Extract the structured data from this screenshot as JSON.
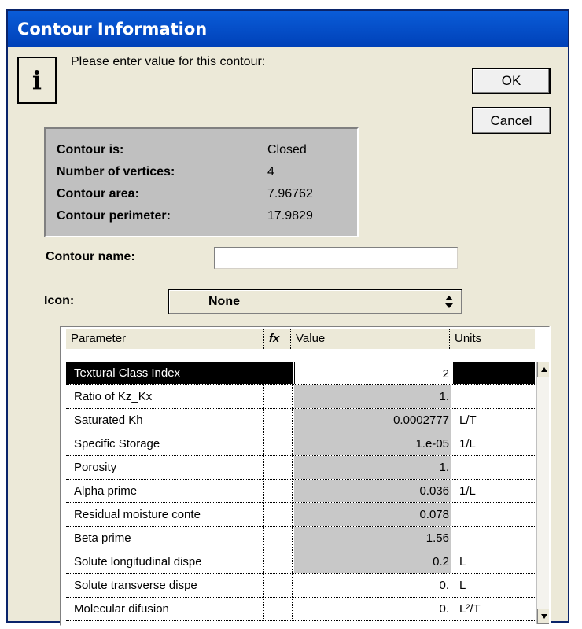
{
  "window": {
    "title": "Contour Information"
  },
  "icons": {
    "info": "info-icon",
    "select_arrow": "up-down-arrow-icon",
    "fx": "function-icon"
  },
  "prompt": {
    "text": "Please enter value for this contour:"
  },
  "buttons": {
    "ok": "OK",
    "cancel": "Cancel"
  },
  "stats": [
    {
      "label": "Contour is:",
      "value": "Closed"
    },
    {
      "label": "Number of vertices:",
      "value": "4"
    },
    {
      "label": "Contour area:",
      "value": "7.96762"
    },
    {
      "label": "Contour perimeter:",
      "value": "17.9829"
    }
  ],
  "contour_name": {
    "label": "Contour name:",
    "value": ""
  },
  "icon_select": {
    "label": "Icon:",
    "selected": "None"
  },
  "grid": {
    "headers": {
      "parameter": "Parameter",
      "fx": "fx",
      "value": "Value",
      "units": "Units"
    },
    "rows": [
      {
        "parameter": "Textural Class Index",
        "value": "2",
        "units": ""
      },
      {
        "parameter": "Ratio of Kz_Kx",
        "value": "1.",
        "units": ""
      },
      {
        "parameter": "Saturated Kh",
        "value": "0.0002777",
        "units": "L/T"
      },
      {
        "parameter": "Specific Storage",
        "value": "1.e-05",
        "units": "1/L"
      },
      {
        "parameter": "Porosity",
        "value": "1.",
        "units": ""
      },
      {
        "parameter": "Alpha prime",
        "value": "0.036",
        "units": "1/L"
      },
      {
        "parameter": "Residual moisture conte",
        "value": "0.078",
        "units": ""
      },
      {
        "parameter": "Beta prime",
        "value": "1.56",
        "units": ""
      },
      {
        "parameter": "Solute longitudinal dispe",
        "value": "0.2",
        "units": "L"
      },
      {
        "parameter": "Solute transverse dispe",
        "value": "0.",
        "units": "L"
      },
      {
        "parameter": "Molecular difusion",
        "value": "0.",
        "units": "L²/T"
      }
    ]
  }
}
